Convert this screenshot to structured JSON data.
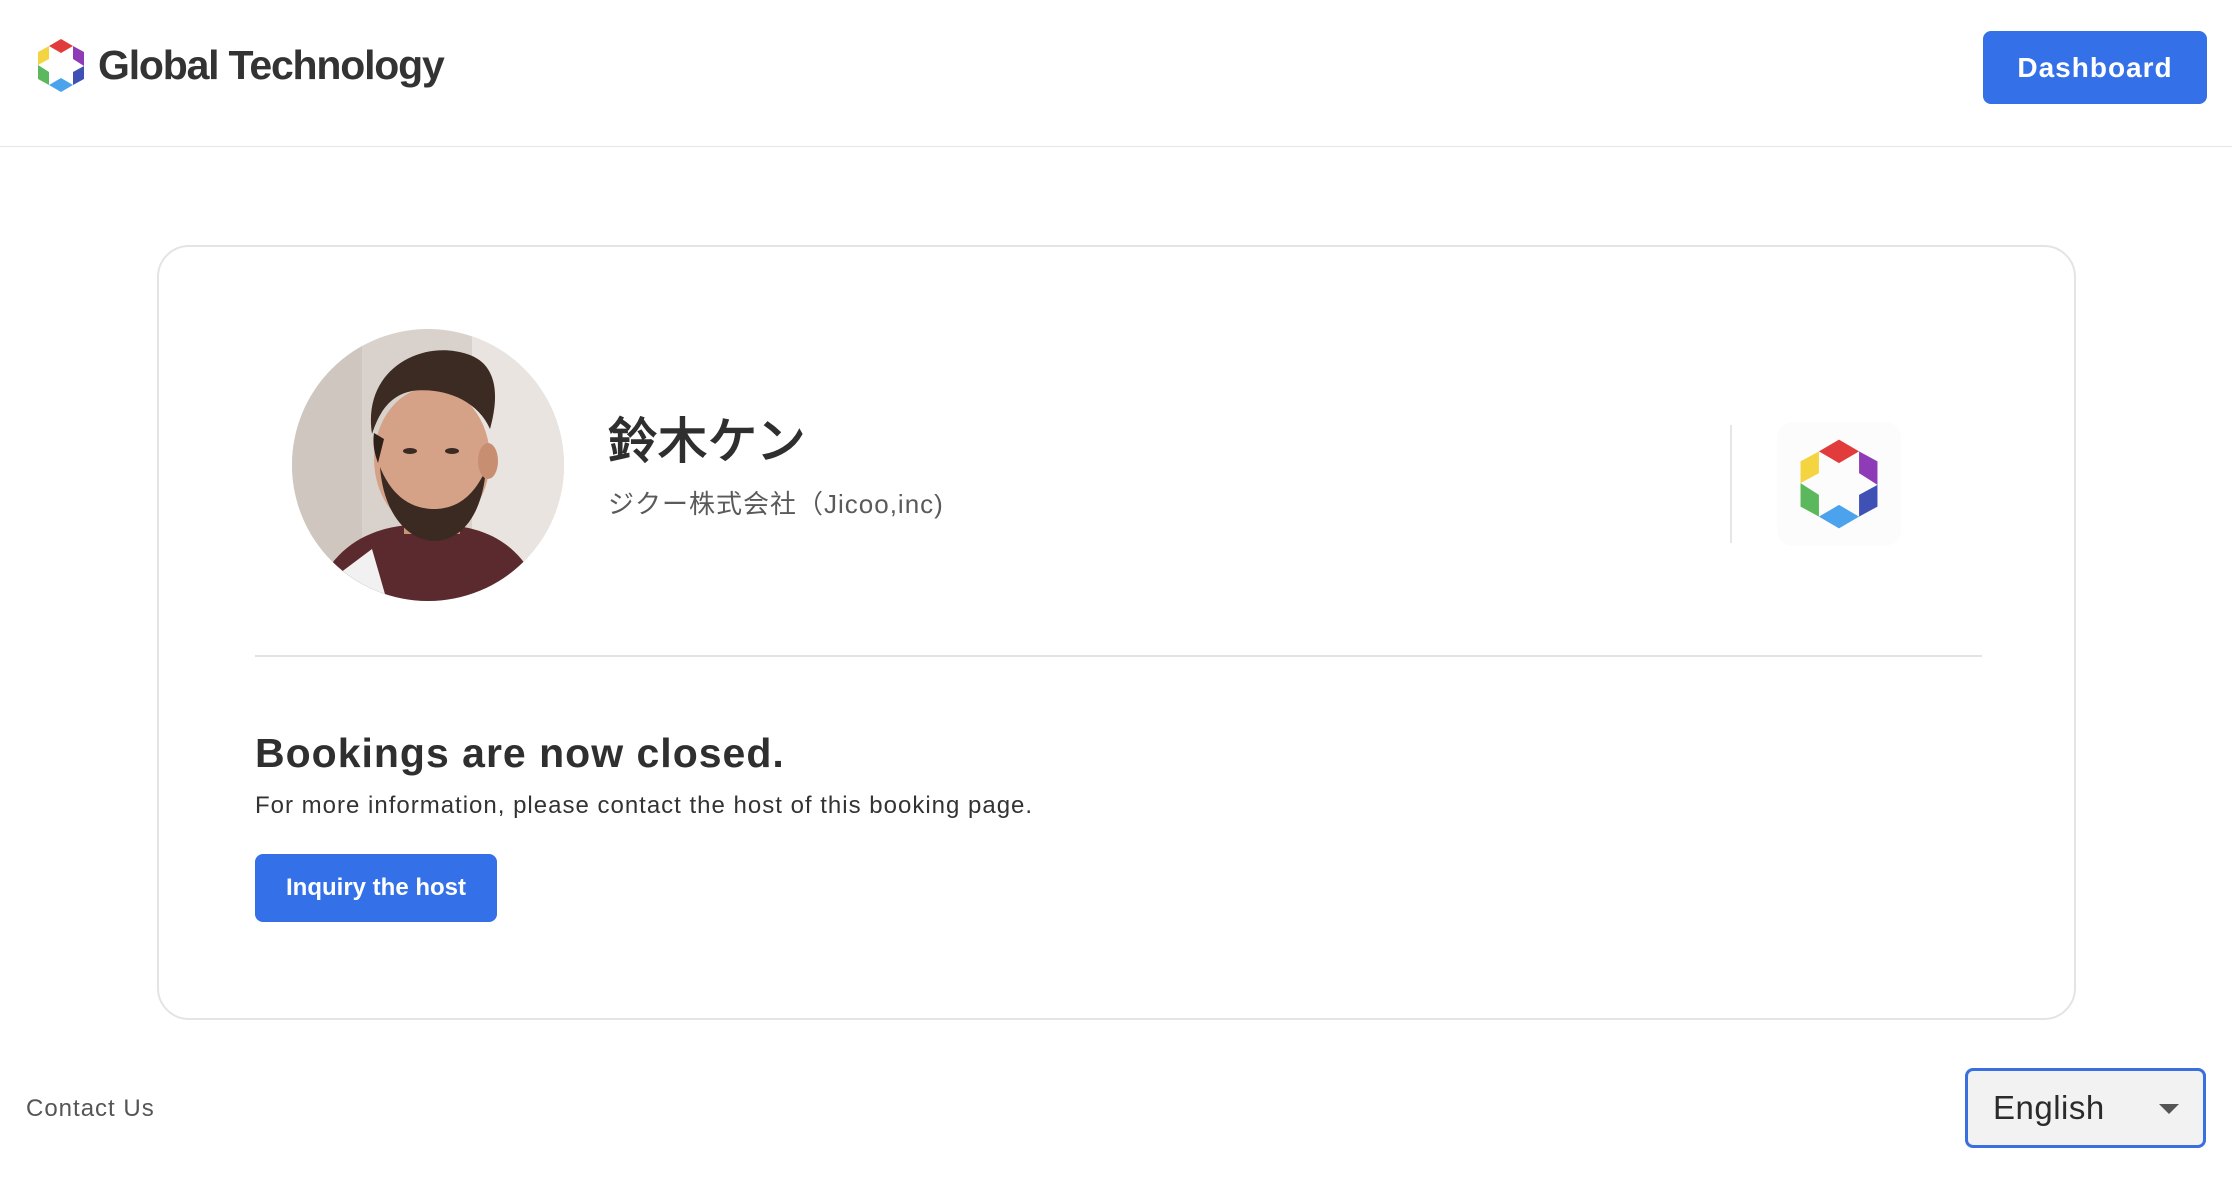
{
  "header": {
    "brand_name": "Global Technology",
    "dashboard_label": "Dashboard"
  },
  "host": {
    "name": "鈴木ケン",
    "company": "ジクー株式会社（Jicoo,inc)"
  },
  "status": {
    "title": "Bookings are now closed.",
    "description": "For more information, please contact the host of this booking page.",
    "inquiry_label": "Inquiry the host"
  },
  "footer": {
    "contact_label": "Contact Us",
    "language_selected": "English"
  },
  "colors": {
    "accent": "#3470e8",
    "logo_red": "#e23b3b",
    "logo_purple": "#8e3bb8",
    "logo_blue": "#3f51b5",
    "logo_lightblue": "#4aa3ec",
    "logo_green": "#5cb85c",
    "logo_yellow": "#f5d442"
  },
  "icons": {
    "brand_logo": "hexagon-aperture-icon",
    "org_logo": "hexagon-aperture-icon",
    "language_caret": "caret-down-icon"
  }
}
